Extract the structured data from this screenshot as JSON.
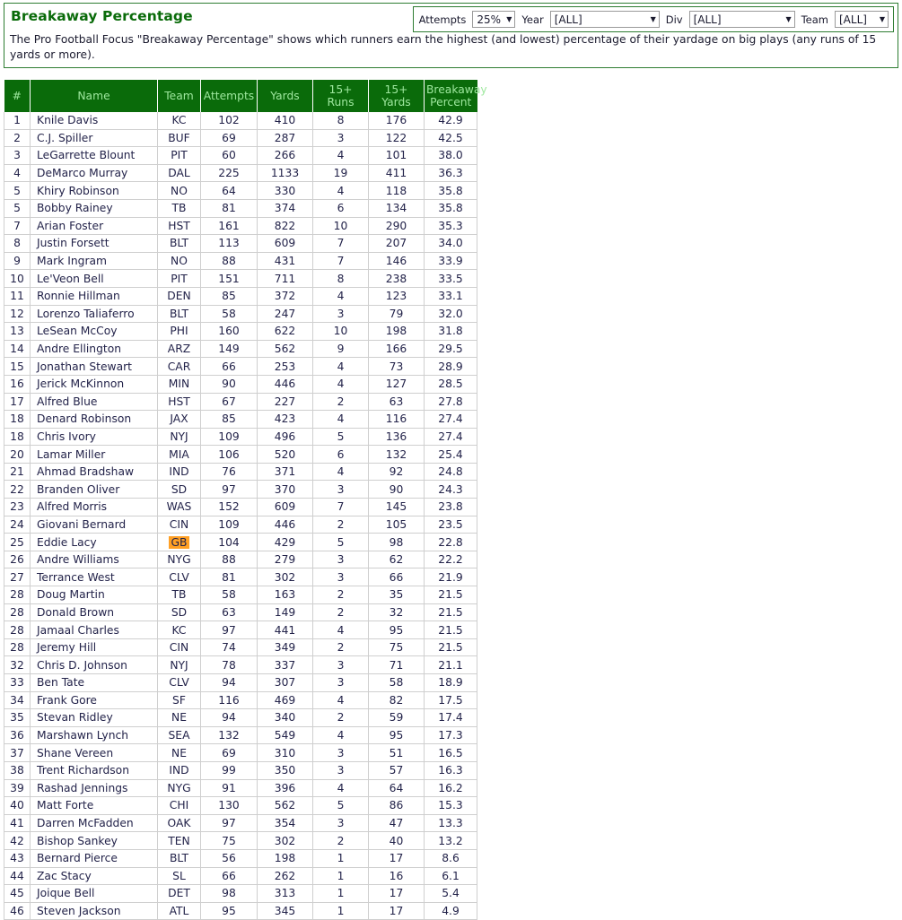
{
  "header": {
    "title": "Breakaway Percentage",
    "description": "The Pro Football Focus \"Breakaway Percentage\" shows which runners earn the highest (and lowest) percentage of their yardage on big plays (any runs of 15 yards or more)."
  },
  "controls": {
    "attempts": {
      "label": "Attempts",
      "value": "25%"
    },
    "year": {
      "label": "Year",
      "value": "[ALL]"
    },
    "div": {
      "label": "Div",
      "value": "[ALL]"
    },
    "team": {
      "label": "Team",
      "value": "[ALL]"
    },
    "arrow_glyph": "▼"
  },
  "colors": {
    "header_green": "#0a6b0a",
    "header_text": "#9fe89f",
    "title_green": "#0a6b0a",
    "highlight_orange": "#ffa025",
    "row_border": "#cfcfcf",
    "text": "#23234a"
  },
  "table": {
    "columns": [
      "#",
      "Name",
      "Team",
      "Attempts",
      "Yards",
      "15+ Runs",
      "15+ Yards",
      "Breakaway Percent"
    ],
    "highlight_team": "GB",
    "rows": [
      {
        "rank": "1",
        "name": "Knile Davis",
        "team": "KC",
        "attempts": "102",
        "yards": "410",
        "runs15": "8",
        "yards15": "176",
        "pct": "42.9"
      },
      {
        "rank": "2",
        "name": "C.J. Spiller",
        "team": "BUF",
        "attempts": "69",
        "yards": "287",
        "runs15": "3",
        "yards15": "122",
        "pct": "42.5"
      },
      {
        "rank": "3",
        "name": "LeGarrette Blount",
        "team": "PIT",
        "attempts": "60",
        "yards": "266",
        "runs15": "4",
        "yards15": "101",
        "pct": "38.0"
      },
      {
        "rank": "4",
        "name": "DeMarco Murray",
        "team": "DAL",
        "attempts": "225",
        "yards": "1133",
        "runs15": "19",
        "yards15": "411",
        "pct": "36.3"
      },
      {
        "rank": "5",
        "name": "Khiry Robinson",
        "team": "NO",
        "attempts": "64",
        "yards": "330",
        "runs15": "4",
        "yards15": "118",
        "pct": "35.8"
      },
      {
        "rank": "5",
        "name": "Bobby Rainey",
        "team": "TB",
        "attempts": "81",
        "yards": "374",
        "runs15": "6",
        "yards15": "134",
        "pct": "35.8"
      },
      {
        "rank": "7",
        "name": "Arian Foster",
        "team": "HST",
        "attempts": "161",
        "yards": "822",
        "runs15": "10",
        "yards15": "290",
        "pct": "35.3"
      },
      {
        "rank": "8",
        "name": "Justin Forsett",
        "team": "BLT",
        "attempts": "113",
        "yards": "609",
        "runs15": "7",
        "yards15": "207",
        "pct": "34.0"
      },
      {
        "rank": "9",
        "name": "Mark Ingram",
        "team": "NO",
        "attempts": "88",
        "yards": "431",
        "runs15": "7",
        "yards15": "146",
        "pct": "33.9"
      },
      {
        "rank": "10",
        "name": "Le'Veon Bell",
        "team": "PIT",
        "attempts": "151",
        "yards": "711",
        "runs15": "8",
        "yards15": "238",
        "pct": "33.5"
      },
      {
        "rank": "11",
        "name": "Ronnie Hillman",
        "team": "DEN",
        "attempts": "85",
        "yards": "372",
        "runs15": "4",
        "yards15": "123",
        "pct": "33.1"
      },
      {
        "rank": "12",
        "name": "Lorenzo Taliaferro",
        "team": "BLT",
        "attempts": "58",
        "yards": "247",
        "runs15": "3",
        "yards15": "79",
        "pct": "32.0"
      },
      {
        "rank": "13",
        "name": "LeSean McCoy",
        "team": "PHI",
        "attempts": "160",
        "yards": "622",
        "runs15": "10",
        "yards15": "198",
        "pct": "31.8"
      },
      {
        "rank": "14",
        "name": "Andre Ellington",
        "team": "ARZ",
        "attempts": "149",
        "yards": "562",
        "runs15": "9",
        "yards15": "166",
        "pct": "29.5"
      },
      {
        "rank": "15",
        "name": "Jonathan Stewart",
        "team": "CAR",
        "attempts": "66",
        "yards": "253",
        "runs15": "4",
        "yards15": "73",
        "pct": "28.9"
      },
      {
        "rank": "16",
        "name": "Jerick McKinnon",
        "team": "MIN",
        "attempts": "90",
        "yards": "446",
        "runs15": "4",
        "yards15": "127",
        "pct": "28.5"
      },
      {
        "rank": "17",
        "name": "Alfred Blue",
        "team": "HST",
        "attempts": "67",
        "yards": "227",
        "runs15": "2",
        "yards15": "63",
        "pct": "27.8"
      },
      {
        "rank": "18",
        "name": "Denard Robinson",
        "team": "JAX",
        "attempts": "85",
        "yards": "423",
        "runs15": "4",
        "yards15": "116",
        "pct": "27.4"
      },
      {
        "rank": "18",
        "name": "Chris Ivory",
        "team": "NYJ",
        "attempts": "109",
        "yards": "496",
        "runs15": "5",
        "yards15": "136",
        "pct": "27.4"
      },
      {
        "rank": "20",
        "name": "Lamar Miller",
        "team": "MIA",
        "attempts": "106",
        "yards": "520",
        "runs15": "6",
        "yards15": "132",
        "pct": "25.4"
      },
      {
        "rank": "21",
        "name": "Ahmad Bradshaw",
        "team": "IND",
        "attempts": "76",
        "yards": "371",
        "runs15": "4",
        "yards15": "92",
        "pct": "24.8"
      },
      {
        "rank": "22",
        "name": "Branden Oliver",
        "team": "SD",
        "attempts": "97",
        "yards": "370",
        "runs15": "3",
        "yards15": "90",
        "pct": "24.3"
      },
      {
        "rank": "23",
        "name": "Alfred Morris",
        "team": "WAS",
        "attempts": "152",
        "yards": "609",
        "runs15": "7",
        "yards15": "145",
        "pct": "23.8"
      },
      {
        "rank": "24",
        "name": "Giovani Bernard",
        "team": "CIN",
        "attempts": "109",
        "yards": "446",
        "runs15": "2",
        "yards15": "105",
        "pct": "23.5"
      },
      {
        "rank": "25",
        "name": "Eddie Lacy",
        "team": "GB",
        "attempts": "104",
        "yards": "429",
        "runs15": "5",
        "yards15": "98",
        "pct": "22.8"
      },
      {
        "rank": "26",
        "name": "Andre Williams",
        "team": "NYG",
        "attempts": "88",
        "yards": "279",
        "runs15": "3",
        "yards15": "62",
        "pct": "22.2"
      },
      {
        "rank": "27",
        "name": "Terrance West",
        "team": "CLV",
        "attempts": "81",
        "yards": "302",
        "runs15": "3",
        "yards15": "66",
        "pct": "21.9"
      },
      {
        "rank": "28",
        "name": "Doug Martin",
        "team": "TB",
        "attempts": "58",
        "yards": "163",
        "runs15": "2",
        "yards15": "35",
        "pct": "21.5"
      },
      {
        "rank": "28",
        "name": "Donald Brown",
        "team": "SD",
        "attempts": "63",
        "yards": "149",
        "runs15": "2",
        "yards15": "32",
        "pct": "21.5"
      },
      {
        "rank": "28",
        "name": "Jamaal Charles",
        "team": "KC",
        "attempts": "97",
        "yards": "441",
        "runs15": "4",
        "yards15": "95",
        "pct": "21.5"
      },
      {
        "rank": "28",
        "name": "Jeremy Hill",
        "team": "CIN",
        "attempts": "74",
        "yards": "349",
        "runs15": "2",
        "yards15": "75",
        "pct": "21.5"
      },
      {
        "rank": "32",
        "name": "Chris D. Johnson",
        "team": "NYJ",
        "attempts": "78",
        "yards": "337",
        "runs15": "3",
        "yards15": "71",
        "pct": "21.1"
      },
      {
        "rank": "33",
        "name": "Ben Tate",
        "team": "CLV",
        "attempts": "94",
        "yards": "307",
        "runs15": "3",
        "yards15": "58",
        "pct": "18.9"
      },
      {
        "rank": "34",
        "name": "Frank Gore",
        "team": "SF",
        "attempts": "116",
        "yards": "469",
        "runs15": "4",
        "yards15": "82",
        "pct": "17.5"
      },
      {
        "rank": "35",
        "name": "Stevan Ridley",
        "team": "NE",
        "attempts": "94",
        "yards": "340",
        "runs15": "2",
        "yards15": "59",
        "pct": "17.4"
      },
      {
        "rank": "36",
        "name": "Marshawn Lynch",
        "team": "SEA",
        "attempts": "132",
        "yards": "549",
        "runs15": "4",
        "yards15": "95",
        "pct": "17.3"
      },
      {
        "rank": "37",
        "name": "Shane Vereen",
        "team": "NE",
        "attempts": "69",
        "yards": "310",
        "runs15": "3",
        "yards15": "51",
        "pct": "16.5"
      },
      {
        "rank": "38",
        "name": "Trent Richardson",
        "team": "IND",
        "attempts": "99",
        "yards": "350",
        "runs15": "3",
        "yards15": "57",
        "pct": "16.3"
      },
      {
        "rank": "39",
        "name": "Rashad Jennings",
        "team": "NYG",
        "attempts": "91",
        "yards": "396",
        "runs15": "4",
        "yards15": "64",
        "pct": "16.2"
      },
      {
        "rank": "40",
        "name": "Matt Forte",
        "team": "CHI",
        "attempts": "130",
        "yards": "562",
        "runs15": "5",
        "yards15": "86",
        "pct": "15.3"
      },
      {
        "rank": "41",
        "name": "Darren McFadden",
        "team": "OAK",
        "attempts": "97",
        "yards": "354",
        "runs15": "3",
        "yards15": "47",
        "pct": "13.3"
      },
      {
        "rank": "42",
        "name": "Bishop Sankey",
        "team": "TEN",
        "attempts": "75",
        "yards": "302",
        "runs15": "2",
        "yards15": "40",
        "pct": "13.2"
      },
      {
        "rank": "43",
        "name": "Bernard Pierce",
        "team": "BLT",
        "attempts": "56",
        "yards": "198",
        "runs15": "1",
        "yards15": "17",
        "pct": "8.6"
      },
      {
        "rank": "44",
        "name": "Zac Stacy",
        "team": "SL",
        "attempts": "66",
        "yards": "262",
        "runs15": "1",
        "yards15": "16",
        "pct": "6.1"
      },
      {
        "rank": "45",
        "name": "Joique Bell",
        "team": "DET",
        "attempts": "98",
        "yards": "313",
        "runs15": "1",
        "yards15": "17",
        "pct": "5.4"
      },
      {
        "rank": "46",
        "name": "Steven Jackson",
        "team": "ATL",
        "attempts": "95",
        "yards": "345",
        "runs15": "1",
        "yards15": "17",
        "pct": "4.9"
      }
    ]
  }
}
